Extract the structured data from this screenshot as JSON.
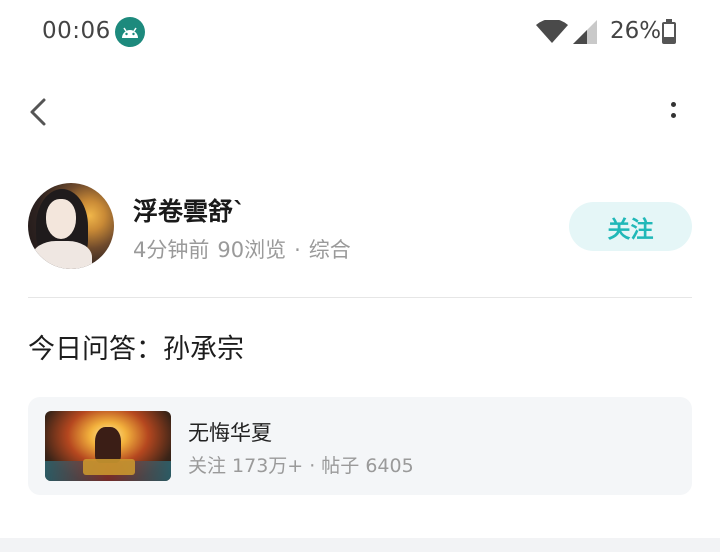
{
  "status_bar": {
    "time": "00:06",
    "battery_percent": "26%",
    "battery_level": 0.26,
    "icons": [
      "android-icon",
      "wifi-icon",
      "cell-signal-icon",
      "battery-icon"
    ]
  },
  "toolbar": {
    "back_icon": "chevron-left-icon",
    "more_icon": "more-vertical-icon"
  },
  "author": {
    "name": "浮卷雲舒`",
    "time_ago": "4分钟前",
    "views": "90浏览",
    "separator": "·",
    "category": "综合",
    "follow_label": "关注"
  },
  "post": {
    "title": "今日问答：孙承宗"
  },
  "game_card": {
    "name": "无悔华夏",
    "followers": "关注 173万+",
    "separator": "·",
    "posts": "帖子 6405"
  },
  "colors": {
    "accent": "#20b8b8",
    "follow_bg": "#e5f6f7",
    "meta_text": "#9a9a9a",
    "card_bg": "#f4f6f8"
  }
}
